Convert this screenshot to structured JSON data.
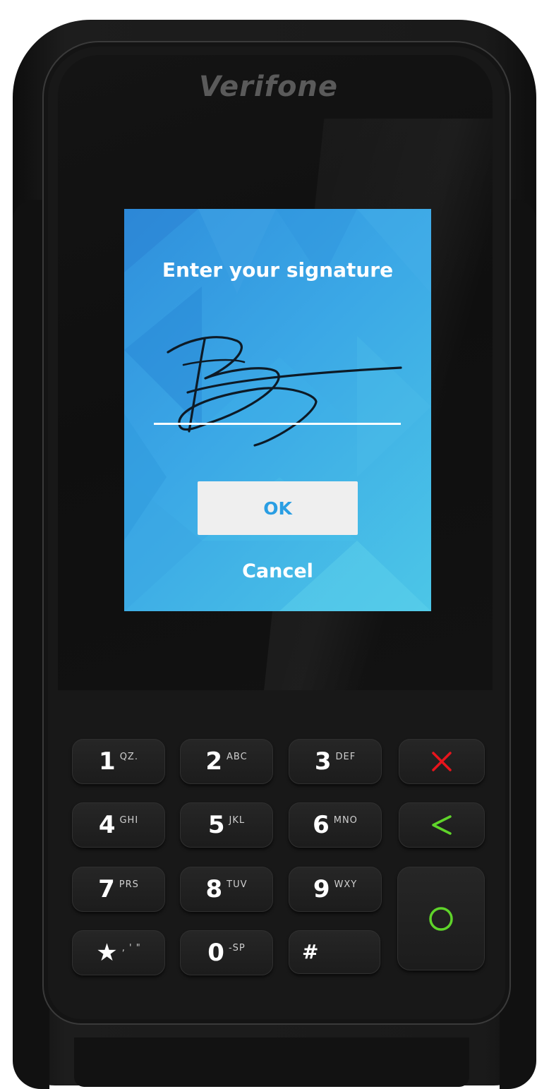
{
  "device": {
    "brand": "Verifone"
  },
  "screen": {
    "title": "Enter your signature",
    "ok_label": "OK",
    "cancel_label": "Cancel"
  },
  "keypad": {
    "keys": [
      {
        "digit": "1",
        "letters": "QZ."
      },
      {
        "digit": "2",
        "letters": "ABC"
      },
      {
        "digit": "3",
        "letters": "DEF"
      },
      {
        "digit": "4",
        "letters": "GHI"
      },
      {
        "digit": "5",
        "letters": "JKL"
      },
      {
        "digit": "6",
        "letters": "MNO"
      },
      {
        "digit": "7",
        "letters": "PRS"
      },
      {
        "digit": "8",
        "letters": "TUV"
      },
      {
        "digit": "9",
        "letters": "WXY"
      },
      {
        "digit": "★",
        "letters": ", ' \""
      },
      {
        "digit": "0",
        "letters": "-SP"
      },
      {
        "digit": "#",
        "letters": ""
      }
    ],
    "function_keys": {
      "cancel_icon": "red-x-icon",
      "clear_icon": "green-backspace-chevron-icon",
      "enter_icon": "green-circle-icon"
    }
  },
  "colors": {
    "screen_gradient_start": "#2f8fdc",
    "screen_gradient_end": "#4cc6e7",
    "ok_text": "#2a9ee3",
    "cancel_key": "#e8141c",
    "clear_key": "#5fd42a",
    "enter_key": "#5fd42a"
  }
}
